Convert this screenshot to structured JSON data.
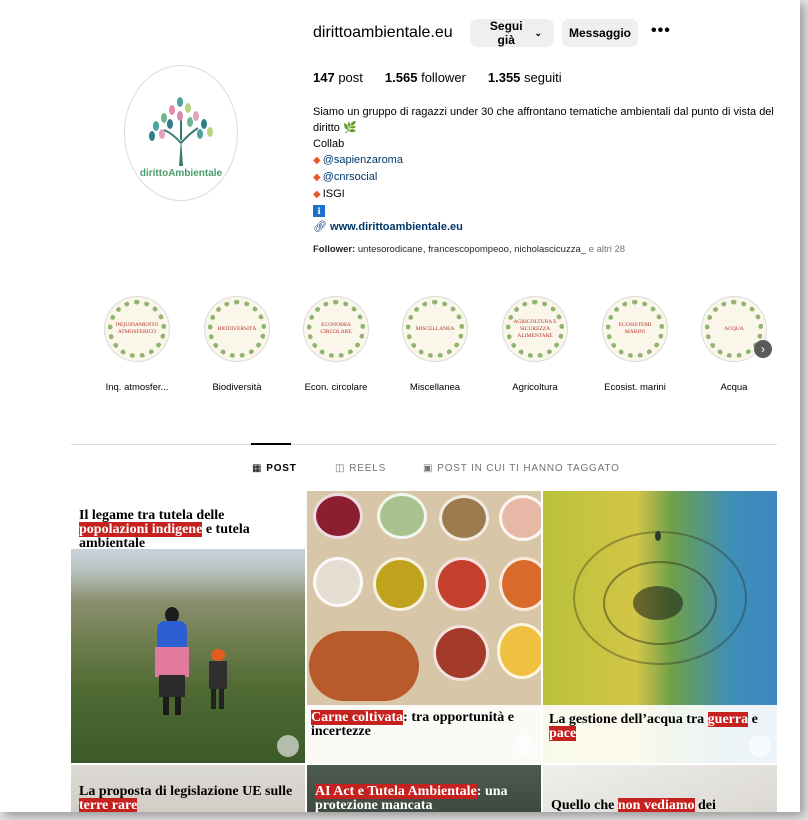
{
  "profile": {
    "username": "dirittoambientale.eu",
    "follow_label": "Segui già",
    "message_label": "Messaggio",
    "more_label": "•••",
    "avatar_text": "dirittoAmbientale",
    "stats": {
      "posts_count": "147",
      "posts_label": "post",
      "followers_count": "1.565",
      "followers_label": "follower",
      "following_count": "1.355",
      "following_label": "seguiti"
    },
    "bio": {
      "line1": "Siamo un gruppo di ragazzi under 30 che affrontano tematiche ambientali dal punto di vista del",
      "line2": "diritto",
      "line2_emoji": "🌿",
      "line3": "Collab",
      "mention1": "@sapienzaroma",
      "mention2": "@cnrsocial",
      "mention3": "ISGI",
      "info_icon": "ℹ",
      "website": "www.dirittoambientale.eu"
    },
    "followed_by_prefix": "Follower:",
    "followed_by_names": "untesorodicane, francescopompeoo, nicholascicuzza_",
    "followed_by_suffix": "e altri 28"
  },
  "highlights": [
    {
      "caption": "Inq. atmosfer...",
      "cover_text": "INQUINAMENTO ATMOSFERICO"
    },
    {
      "caption": "Biodiversità",
      "cover_text": "BIODIVERSITÀ"
    },
    {
      "caption": "Econ. circolare",
      "cover_text": "ECONOMIA CIRCOLARE"
    },
    {
      "caption": "Miscellanea",
      "cover_text": "MISCELLANEA"
    },
    {
      "caption": "Agricoltura",
      "cover_text": "AGRICOLTURA E SICUREZZA ALIMENTARE"
    },
    {
      "caption": "Ecosist. marini",
      "cover_text": "ECOSISTEMI MARINI"
    },
    {
      "caption": "Acqua",
      "cover_text": "ACQUA"
    }
  ],
  "tabs": {
    "posts": "POST",
    "reels": "REELS",
    "tagged": "POST IN CUI TI HANNO TAGGATO"
  },
  "posts": [
    {
      "pre": "Il legame tra tutela delle",
      "highlight": "popolazioni indigene",
      "post": "e tutela ambientale"
    },
    {
      "pre": "",
      "highlight": "Carne coltivata",
      "post": ": tra opportunità e incertezze"
    },
    {
      "pre": "La gestione dell’acqua tra",
      "highlight": "guerra",
      "mid": "e",
      "highlight2": "pace"
    },
    {
      "pre": "La proposta di legislazione UE sulle",
      "highlight": "terre rare",
      "post": ""
    },
    {
      "pre": "",
      "highlight": "AI Act e Tutela Ambientale",
      "post": ": una protezione mancata"
    },
    {
      "pre": "Quello che",
      "highlight": "non vediamo",
      "post": "dei"
    }
  ],
  "colors": {
    "accent_red": "#c5221f",
    "button_bg": "#efefef",
    "link": "#00376b"
  }
}
